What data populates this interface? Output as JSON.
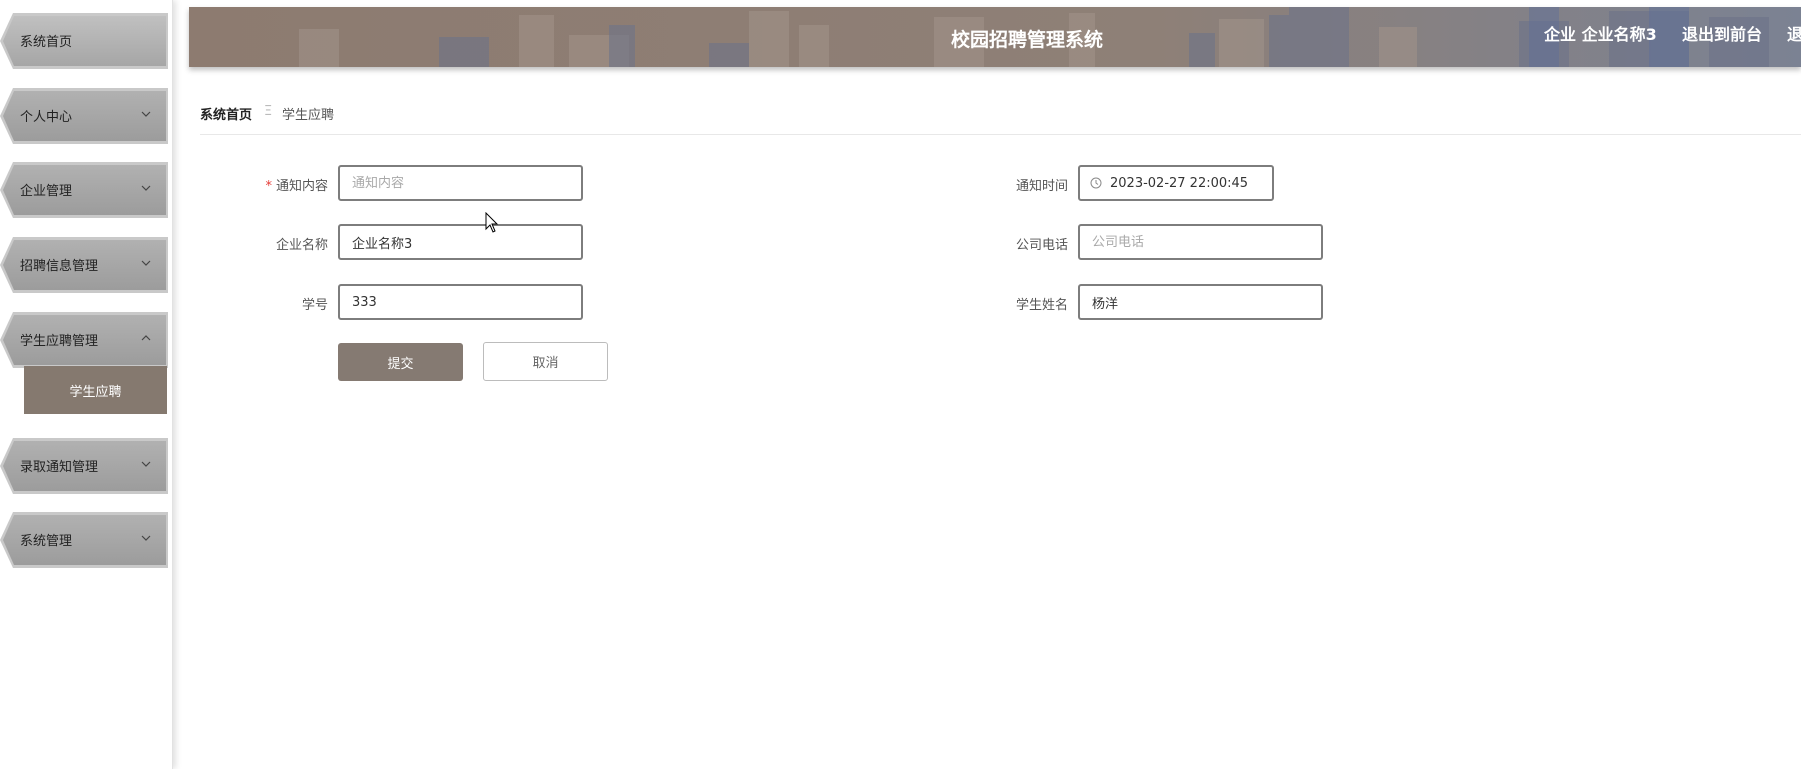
{
  "header": {
    "title": "校园招聘管理系统",
    "user": "企业 企业名称3",
    "exit_front": "退出到前台",
    "logout_partial": "退"
  },
  "sidebar": {
    "items": [
      {
        "label": "系统首页"
      },
      {
        "label": "个人中心"
      },
      {
        "label": "企业管理"
      },
      {
        "label": "招聘信息管理"
      },
      {
        "label": "学生应聘管理",
        "expanded": true,
        "children": [
          {
            "label": "学生应聘",
            "active": true
          }
        ]
      },
      {
        "label": "录取通知管理"
      },
      {
        "label": "系统管理"
      }
    ]
  },
  "breadcrumb": {
    "home": "系统首页",
    "separator": "Ξ",
    "current": "学生应聘"
  },
  "form": {
    "notice_content": {
      "label": "通知内容",
      "required_mark": "*",
      "value": "",
      "placeholder": "通知内容"
    },
    "notice_time": {
      "label": "通知时间",
      "value": "2023-02-27 22:00:45"
    },
    "company_name": {
      "label": "企业名称",
      "value": "企业名称3"
    },
    "company_phone": {
      "label": "公司电话",
      "value": "",
      "placeholder": "公司电话"
    },
    "student_id": {
      "label": "学号",
      "value": "333"
    },
    "student_name": {
      "label": "学生姓名",
      "value": "杨洋"
    },
    "submit_label": "提交",
    "cancel_label": "取消"
  },
  "colors": {
    "accent": "#857a72",
    "header_bg": "#8f7f74",
    "menu_gray": "#a6a6a6",
    "required": "#e53935"
  }
}
